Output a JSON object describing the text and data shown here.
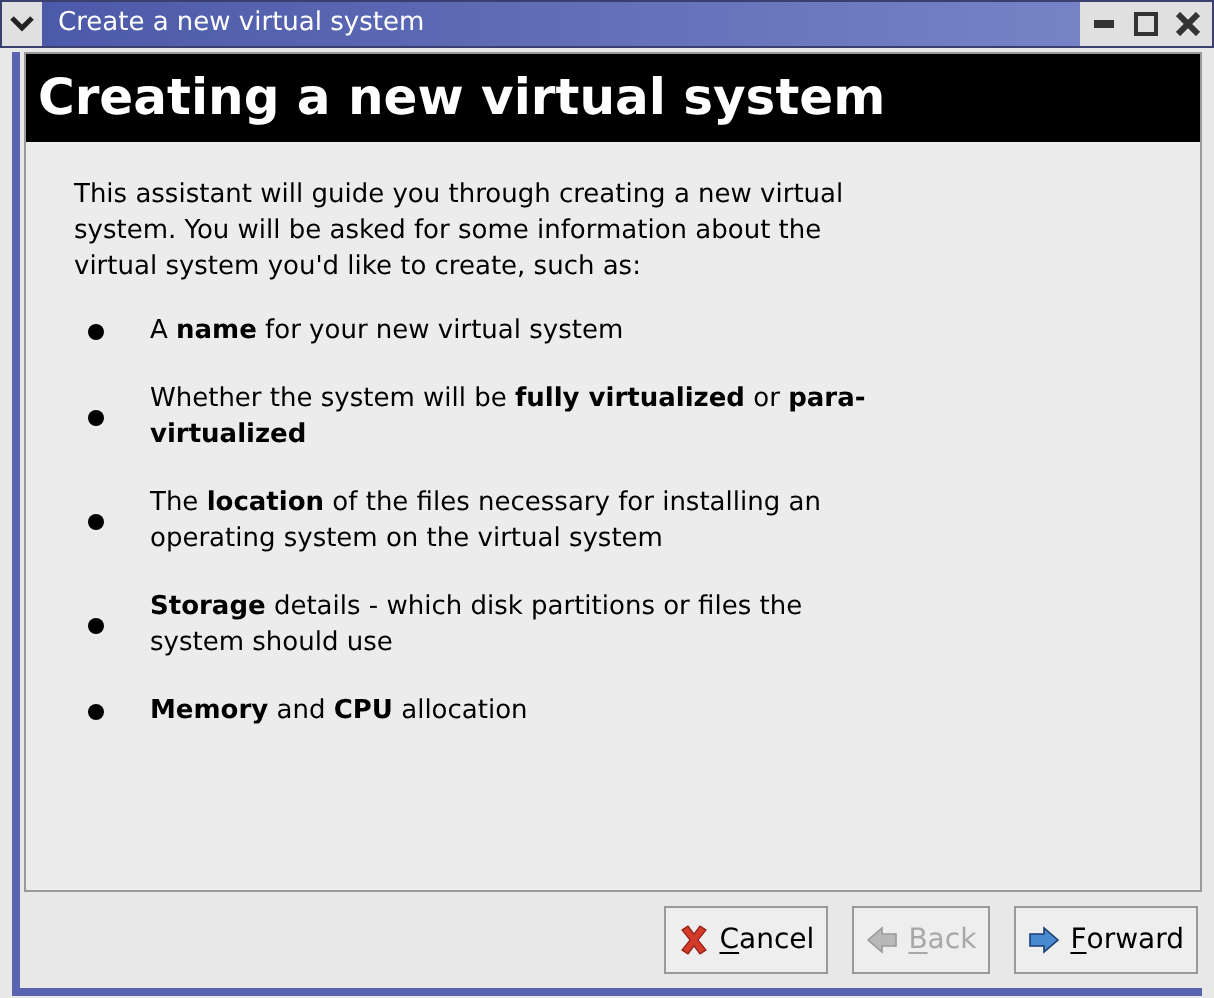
{
  "window": {
    "title": "Create a new virtual system"
  },
  "header": {
    "title": "Creating a new virtual system"
  },
  "intro": "This assistant will guide you through creating a new virtual system. You will be asked for some information about the virtual system you'd like to create, such as:",
  "bullets": [
    {
      "text": "A **name** for your new virtual system"
    },
    {
      "text": "Whether the system will be **fully virtualized** or **para-virtualized**"
    },
    {
      "text": "The **location** of the files necessary for installing an operating system on the virtual system"
    },
    {
      "text": "**Storage** details - which disk partitions or files the system should use"
    },
    {
      "text": "**Memory** and **CPU** allocation"
    }
  ],
  "buttons": [
    {
      "label": "Cancel",
      "kind": "cancel",
      "disabled": false
    },
    {
      "label": "Back",
      "kind": "back",
      "disabled": true
    },
    {
      "label": "Forward",
      "kind": "forward",
      "disabled": false
    }
  ]
}
